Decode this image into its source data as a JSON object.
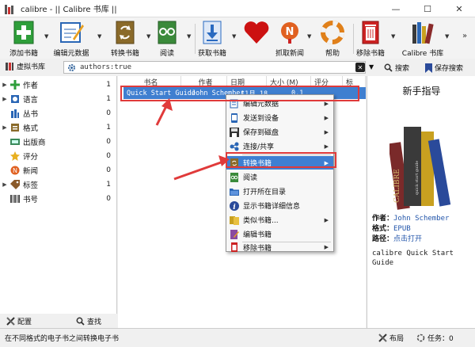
{
  "window": {
    "title": "calibre - || Calibre 书库 ||",
    "min_glyph": "—",
    "max_glyph": "☐",
    "close_glyph": "✕"
  },
  "toolbar": {
    "items": [
      {
        "label": "添加书籍",
        "icon": "add-book-icon",
        "color": "#2e9e3a"
      },
      {
        "label": "编辑元数据",
        "icon": "edit-metadata-icon",
        "color": "#2a66b5"
      },
      {
        "label": "转换书籍",
        "icon": "convert-books-icon",
        "color": "#8a6a2a"
      },
      {
        "label": "阅读",
        "icon": "view-book-icon",
        "color": "#3a8a3a"
      },
      {
        "label": "获取书籍",
        "icon": "get-books-icon",
        "color": "#2a6ac0"
      },
      {
        "label": "",
        "icon": "donate-heart-icon",
        "color": "#cc1111"
      },
      {
        "label": "抓取新闻",
        "icon": "fetch-news-icon",
        "color": "#e06020"
      },
      {
        "label": "帮助",
        "icon": "help-lifebuoy-icon",
        "color": "#e0801a"
      },
      {
        "label": "移除书籍",
        "icon": "remove-books-icon",
        "color": "#cc2222"
      },
      {
        "label": "Calibre 书库",
        "icon": "library-icon",
        "color": "#444444"
      }
    ],
    "more_glyph": "»"
  },
  "searchbar": {
    "virtual_library_label": "虚拟书库",
    "query": "authors:true",
    "search_label": "搜索",
    "saved_search_label": "保存搜索"
  },
  "tag_browser": {
    "items": [
      {
        "label": "作者",
        "count": "1",
        "icon": "author-icon"
      },
      {
        "label": "语言",
        "count": "1",
        "icon": "language-icon"
      },
      {
        "label": "丛书",
        "count": "0",
        "icon": "series-icon"
      },
      {
        "label": "格式",
        "count": "1",
        "icon": "formats-icon"
      },
      {
        "label": "出版商",
        "count": "0",
        "icon": "publisher-icon"
      },
      {
        "label": "评分",
        "count": "0",
        "icon": "rating-icon"
      },
      {
        "label": "新闻",
        "count": "0",
        "icon": "news-icon"
      },
      {
        "label": "标签",
        "count": "1",
        "icon": "tags-icon"
      },
      {
        "label": "书号",
        "count": "0",
        "icon": "identifiers-icon"
      }
    ],
    "configure_label": "配置",
    "find_label": "查找"
  },
  "book_list": {
    "columns": [
      "书名",
      "作者",
      "日期",
      "大小 (M)",
      "评分",
      "标"
    ],
    "row": {
      "title": "Quick Start Guide",
      "author": "John Schember",
      "date": "11月 18",
      "size": "0.1"
    }
  },
  "context_menu": {
    "items": [
      {
        "label": "编辑元数据",
        "submenu": true,
        "icon": "edit-metadata-icon"
      },
      {
        "label": "发送到设备",
        "submenu": true,
        "icon": "send-device-icon"
      },
      {
        "label": "保存到磁盘",
        "submenu": true,
        "icon": "save-disk-icon"
      },
      {
        "label": "连接/共享",
        "submenu": true,
        "icon": "connect-share-icon"
      },
      {
        "label": "转换书籍",
        "submenu": true,
        "icon": "convert-books-icon",
        "active": true
      },
      {
        "label": "阅读",
        "submenu": false,
        "icon": "view-book-icon"
      },
      {
        "label": "打开所在目录",
        "submenu": false,
        "icon": "open-folder-icon"
      },
      {
        "label": "显示书籍详细信息",
        "submenu": false,
        "icon": "book-details-icon"
      },
      {
        "label": "类似书籍...",
        "submenu": true,
        "icon": "similar-books-icon"
      },
      {
        "label": "编辑书籍",
        "submenu": false,
        "icon": "edit-book-icon"
      },
      {
        "label": "移除书籍",
        "submenu": true,
        "icon": "remove-books-icon"
      }
    ]
  },
  "book_details": {
    "header": "新手指导",
    "cover_text": "CALIBRE",
    "cover_subtext": "quick start guide",
    "author_label": "作者：",
    "author_value": "John Schember",
    "format_label": "格式：",
    "format_value": "EPUB",
    "path_label": "路径：",
    "path_value": "点击打开",
    "description": "calibre Quick Start Guide"
  },
  "statusbar": {
    "message": "在不同格式的电子书之间转换电子书",
    "layout_label": "布局",
    "jobs_label": "任务：0"
  }
}
